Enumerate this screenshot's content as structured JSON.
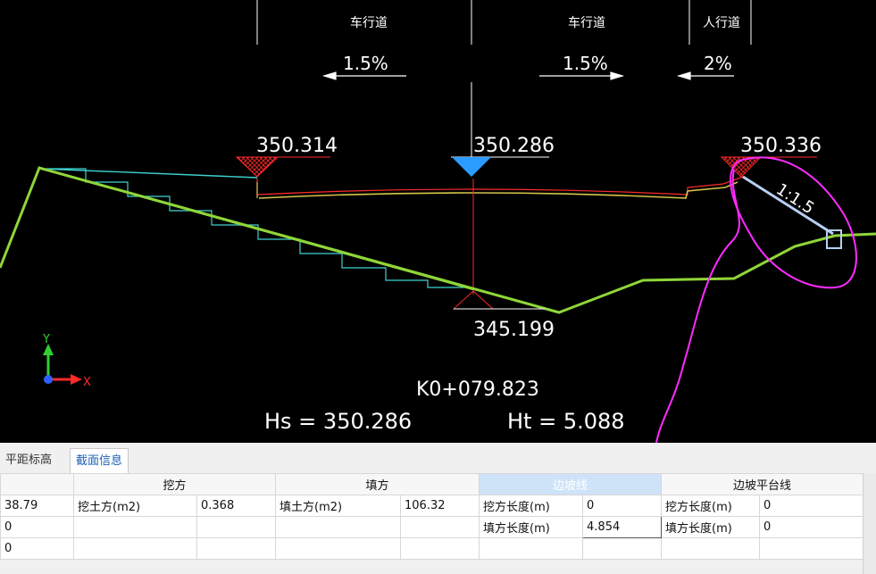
{
  "cad": {
    "lane_left": "车行道",
    "lane_right": "车行道",
    "lane_sidewalk": "人行道",
    "slope_left": "1.5%",
    "slope_right": "1.5%",
    "slope_sidewalk": "2%",
    "elev_left": "350.314",
    "elev_center": "350.286",
    "elev_right": "350.336",
    "elev_bottom": "345.199",
    "slope_ratio": "1:1.5",
    "station": "K0+079.823",
    "hs_label": "Hs  =  350.286",
    "ht_label": "Ht  =  5.088",
    "axis_y": "Y",
    "axis_x": "X",
    "colors": {
      "green": "#8fd639",
      "red": "#ff2a2a",
      "cyan": "#3fd2d2",
      "yellow": "#d6c64a",
      "blue": "#3ba7ff",
      "magenta": "#ff2bff"
    }
  },
  "panel": {
    "tabs": [
      {
        "label": "平距标高"
      },
      {
        "label": "截面信息"
      }
    ],
    "groups": {
      "cut": "挖方",
      "fill": "填方",
      "slope_line": "边坡线",
      "platform_line": "边坡平台线"
    },
    "rows": [
      {
        "c0": "38.79",
        "c1": "挖土方(m2)",
        "c2": "0.368",
        "c3": "填土方(m2)",
        "c4": "106.32",
        "c5": "挖方长度(m)",
        "c6": "0",
        "c7": "挖方长度(m)",
        "c8": "0"
      },
      {
        "c0": "0",
        "c1": "",
        "c2": "",
        "c3": "",
        "c4": "",
        "c5": "填方长度(m)",
        "c6": "4.854",
        "c7": "填方长度(m)",
        "c8": "0"
      },
      {
        "c0": "0",
        "c1": "",
        "c2": "",
        "c3": "",
        "c4": "",
        "c5": "",
        "c6": "",
        "c7": "",
        "c8": ""
      }
    ]
  }
}
